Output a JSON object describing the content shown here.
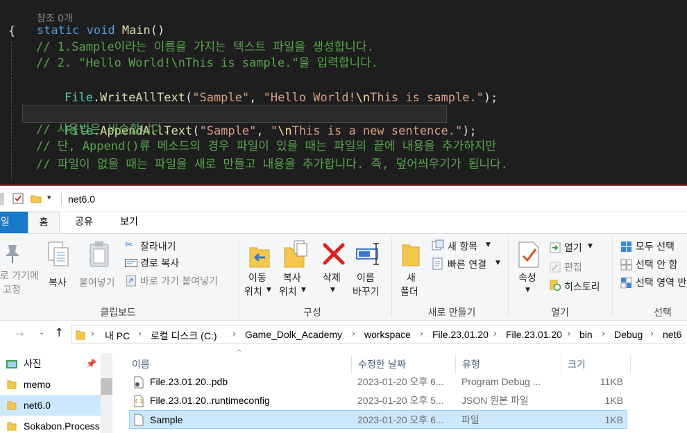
{
  "editor": {
    "references": "참조 0개",
    "lines": {
      "sig_kw1": "static",
      "sig_kw2": "void",
      "sig_name": "Main",
      "sig_rest": "()",
      "open_brace": "{",
      "c1": "// 1.Sample이라는 이름을 가지는 텍스트 파일을 생성합니다.",
      "c2": "// 2. \"Hello World!\\nThis is sample.\"을 입력합니다.",
      "l3_cls": "File",
      "l3_dot": ".",
      "l3_fn": "WriteAllText",
      "l3_p1": "(",
      "l3_s1": "\"Sample\"",
      "l3_comma": ", ",
      "l3_s2a": "\"Hello World!",
      "l3_esc": "\\n",
      "l3_s2b": "This is sample.\"",
      "l3_end": ");",
      "l5_cls": "File",
      "l5_dot": ".",
      "l5_fn": "AppendAllText",
      "l5_p1": "(",
      "l5_s1": "\"Sample\"",
      "l5_comma": ", ",
      "l5_s2a": "\"",
      "l5_esc": "\\n",
      "l5_s2b": "This is a new sentence.\"",
      "l5_end": ");",
      "c6": "// 사용법은 비슷합니다.",
      "c7": "// 단, Append()류 메소드의 경우 파일이 있을 때는 파일의 끝에 내용을 추가하지만",
      "c8": "// 파일이 없을 때는 파일을 새로 만들고 내용을 추가합니다. 즉, 덮어씌우기가 됩니다."
    }
  },
  "titlebar": {
    "title": "net6.0",
    "dropdown": "▾"
  },
  "ribbon_tabs": {
    "file": "파일",
    "home": "홈",
    "share": "공유",
    "view": "보기"
  },
  "ribbon": {
    "clipboard": {
      "label": "클립보드",
      "pin_l1": "로 가기에",
      "pin_l2": "고정",
      "copy": "복사",
      "paste": "붙여넣기",
      "cut": "잘라내기",
      "copy_path": "경로 복사",
      "paste_shortcut": "바로 가기 붙여넣기"
    },
    "organize": {
      "label": "구성",
      "move_l1": "이동",
      "move_l2": "위치",
      "copy_l1": "복사",
      "copy_l2": "위치",
      "delete": "삭제",
      "rename_l1": "이름",
      "rename_l2": "바꾸기"
    },
    "new": {
      "label": "새로 만들기",
      "folder_l1": "새",
      "folder_l2": "폴더",
      "new_item": "새 항목",
      "easy_access": "빠른 연결"
    },
    "open": {
      "label": "열기",
      "properties": "속성",
      "open": "열기",
      "edit": "편집",
      "history": "히스토리"
    },
    "select": {
      "label": "선택",
      "select_all": "모두 선택",
      "select_none": "선택 안 함",
      "invert": "선택 영역 반"
    }
  },
  "address": {
    "crumbs": [
      "내 PC",
      "로컬 디스크 (C:)",
      "Game_Dolk_Academy",
      "workspace",
      "File.23.01.20",
      "File.23.01.20",
      "bin",
      "Debug",
      "net6"
    ]
  },
  "nav": {
    "items": [
      "사진",
      "memo",
      "net6.0",
      "Sokabon.Process"
    ]
  },
  "files": {
    "headers": {
      "name": "이름",
      "modified": "수정한 날짜",
      "type": "유형",
      "size": "크기"
    },
    "rows": [
      {
        "name": "File.23.01.20..pdb",
        "modified": "2023-01-20 오후 6...",
        "type": "Program Debug ...",
        "size": "11KB"
      },
      {
        "name": "File.23.01.20..runtimeconfig",
        "modified": "2023-01-20 오후 5...",
        "type": "JSON 원본 파일",
        "size": "1KB"
      },
      {
        "name": "Sample",
        "modified": "2023-01-20 오후 6...",
        "type": "파일",
        "size": "1KB"
      }
    ]
  }
}
